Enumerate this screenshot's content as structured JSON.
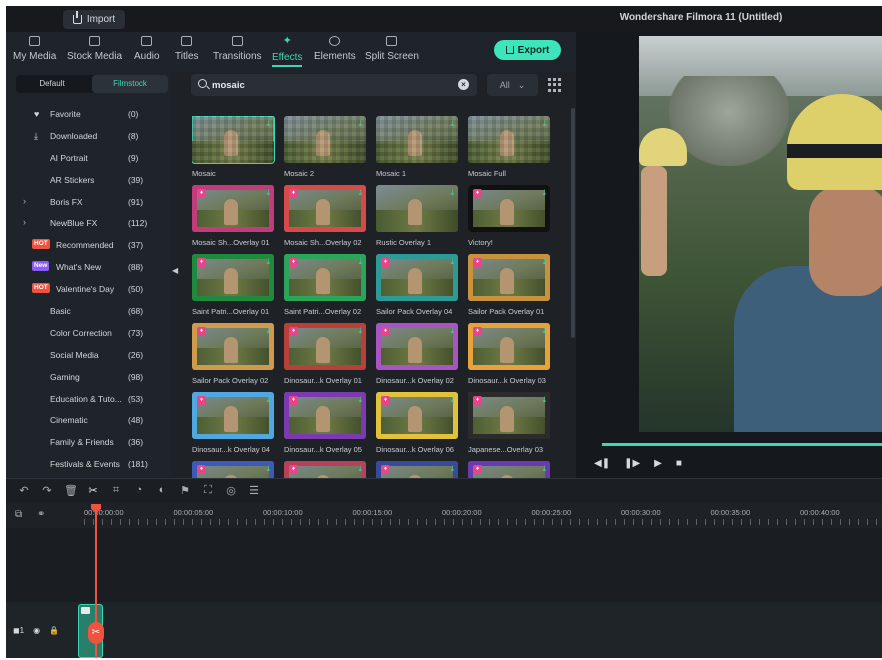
{
  "titlebar": {
    "import_label": "Import",
    "app_title": "Wondershare Filmora 11 (Untitled)"
  },
  "tabs": [
    {
      "label": "My Media",
      "icon": "image-icon"
    },
    {
      "label": "Stock Media",
      "icon": "camera-icon"
    },
    {
      "label": "Audio",
      "icon": "music-icon"
    },
    {
      "label": "Titles",
      "icon": "title-icon"
    },
    {
      "label": "Transitions",
      "icon": "transition-icon"
    },
    {
      "label": "Effects",
      "icon": "sparkle-icon",
      "active": true
    },
    {
      "label": "Elements",
      "icon": "smiley-icon"
    },
    {
      "label": "Split Screen",
      "icon": "split-screen-icon"
    }
  ],
  "export_label": "Export",
  "sidebar": {
    "segments": [
      "Default",
      "Filmstock"
    ],
    "categories": [
      {
        "label": "Favorite",
        "count": "(0)",
        "icon": "heart-icon"
      },
      {
        "label": "Downloaded",
        "count": "(8)",
        "icon": "download-icon"
      },
      {
        "label": "AI Portrait",
        "count": "(9)"
      },
      {
        "label": "AR Stickers",
        "count": "(39)"
      },
      {
        "label": "Boris FX",
        "count": "(91)",
        "expandable": true
      },
      {
        "label": "NewBlue FX",
        "count": "(112)",
        "expandable": true
      },
      {
        "label": "Recommended",
        "count": "(37)",
        "badge": "HOT"
      },
      {
        "label": "What's New",
        "count": "(88)",
        "badge": "New"
      },
      {
        "label": "Valentine's Day",
        "count": "(50)",
        "badge": "HOT"
      },
      {
        "label": "Basic",
        "count": "(68)"
      },
      {
        "label": "Color Correction",
        "count": "(73)"
      },
      {
        "label": "Social Media",
        "count": "(26)"
      },
      {
        "label": "Gaming",
        "count": "(98)"
      },
      {
        "label": "Education & Tuto...",
        "count": "(53)"
      },
      {
        "label": "Cinematic",
        "count": "(48)"
      },
      {
        "label": "Family & Friends",
        "count": "(36)"
      },
      {
        "label": "Festivals & Events",
        "count": "(181)"
      }
    ]
  },
  "search": {
    "value": "mosaic",
    "filter": "All"
  },
  "effects": [
    {
      "label": "Mosaic",
      "style": "mosaic",
      "selected": true
    },
    {
      "label": "Mosaic 2",
      "style": "mosaic"
    },
    {
      "label": "Mosaic 1",
      "style": "mosaic"
    },
    {
      "label": "Mosaic Full",
      "style": "mosaic"
    },
    {
      "label": "Mosaic Sh...Overlay 01",
      "style": "overlay",
      "frame": "#c23b7a"
    },
    {
      "label": "Mosaic Sh...Overlay 02",
      "style": "overlay",
      "frame": "#d84a4a"
    },
    {
      "label": "Rustic Overlay 1",
      "style": "plain"
    },
    {
      "label": "Victory!",
      "style": "overlay",
      "frame": "#111111"
    },
    {
      "label": "Saint Patri...Overlay 01",
      "style": "overlay",
      "frame": "#1f8a3e"
    },
    {
      "label": "Saint Patri...Overlay 02",
      "style": "overlay",
      "frame": "#2aa55a"
    },
    {
      "label": "Sailor Pack Overlay 04",
      "style": "overlay",
      "frame": "#2d9a96"
    },
    {
      "label": "Sailor Pack Overlay 01",
      "style": "overlay",
      "frame": "#c7923e"
    },
    {
      "label": "Sailor Pack Overlay 02",
      "style": "overlay",
      "frame": "#cf9a4c"
    },
    {
      "label": "Dinosaur...k Overlay 01",
      "style": "overlay",
      "frame": "#b8403a"
    },
    {
      "label": "Dinosaur...k Overlay 02",
      "style": "overlay",
      "frame": "#a854c2"
    },
    {
      "label": "Dinosaur...k Overlay 03",
      "style": "overlay",
      "frame": "#e8a23a"
    },
    {
      "label": "Dinosaur...k Overlay 04",
      "style": "overlay",
      "frame": "#4fa8e0"
    },
    {
      "label": "Dinosaur...k Overlay 05",
      "style": "overlay",
      "frame": "#7c3ab0"
    },
    {
      "label": "Dinosaur...k Overlay 06",
      "style": "overlay",
      "frame": "#e2c23a"
    },
    {
      "label": "Japanese...Overlay 03",
      "style": "overlay",
      "frame": "#2b2b2b"
    },
    {
      "label": "",
      "style": "overlay",
      "frame": "#3d5ab8"
    },
    {
      "label": "",
      "style": "overlay",
      "frame": "#b8405a"
    },
    {
      "label": "",
      "style": "overlay",
      "frame": "#3a4a9a"
    },
    {
      "label": "",
      "style": "overlay",
      "frame": "#6a3ab0"
    }
  ],
  "timeline": {
    "ticks": [
      "00:00:00:00",
      "00:00:05:00",
      "00:00:10:00",
      "00:00:15:00",
      "00:00:20:00",
      "00:00:25:00",
      "00:00:30:00",
      "00:00:35:00",
      "00:00:40:00"
    ],
    "track_label": "1"
  },
  "colors": {
    "accent": "#3fd7b1",
    "playhead": "#f0523f",
    "hot": "#f0523f",
    "new": "#8b5cf6"
  }
}
